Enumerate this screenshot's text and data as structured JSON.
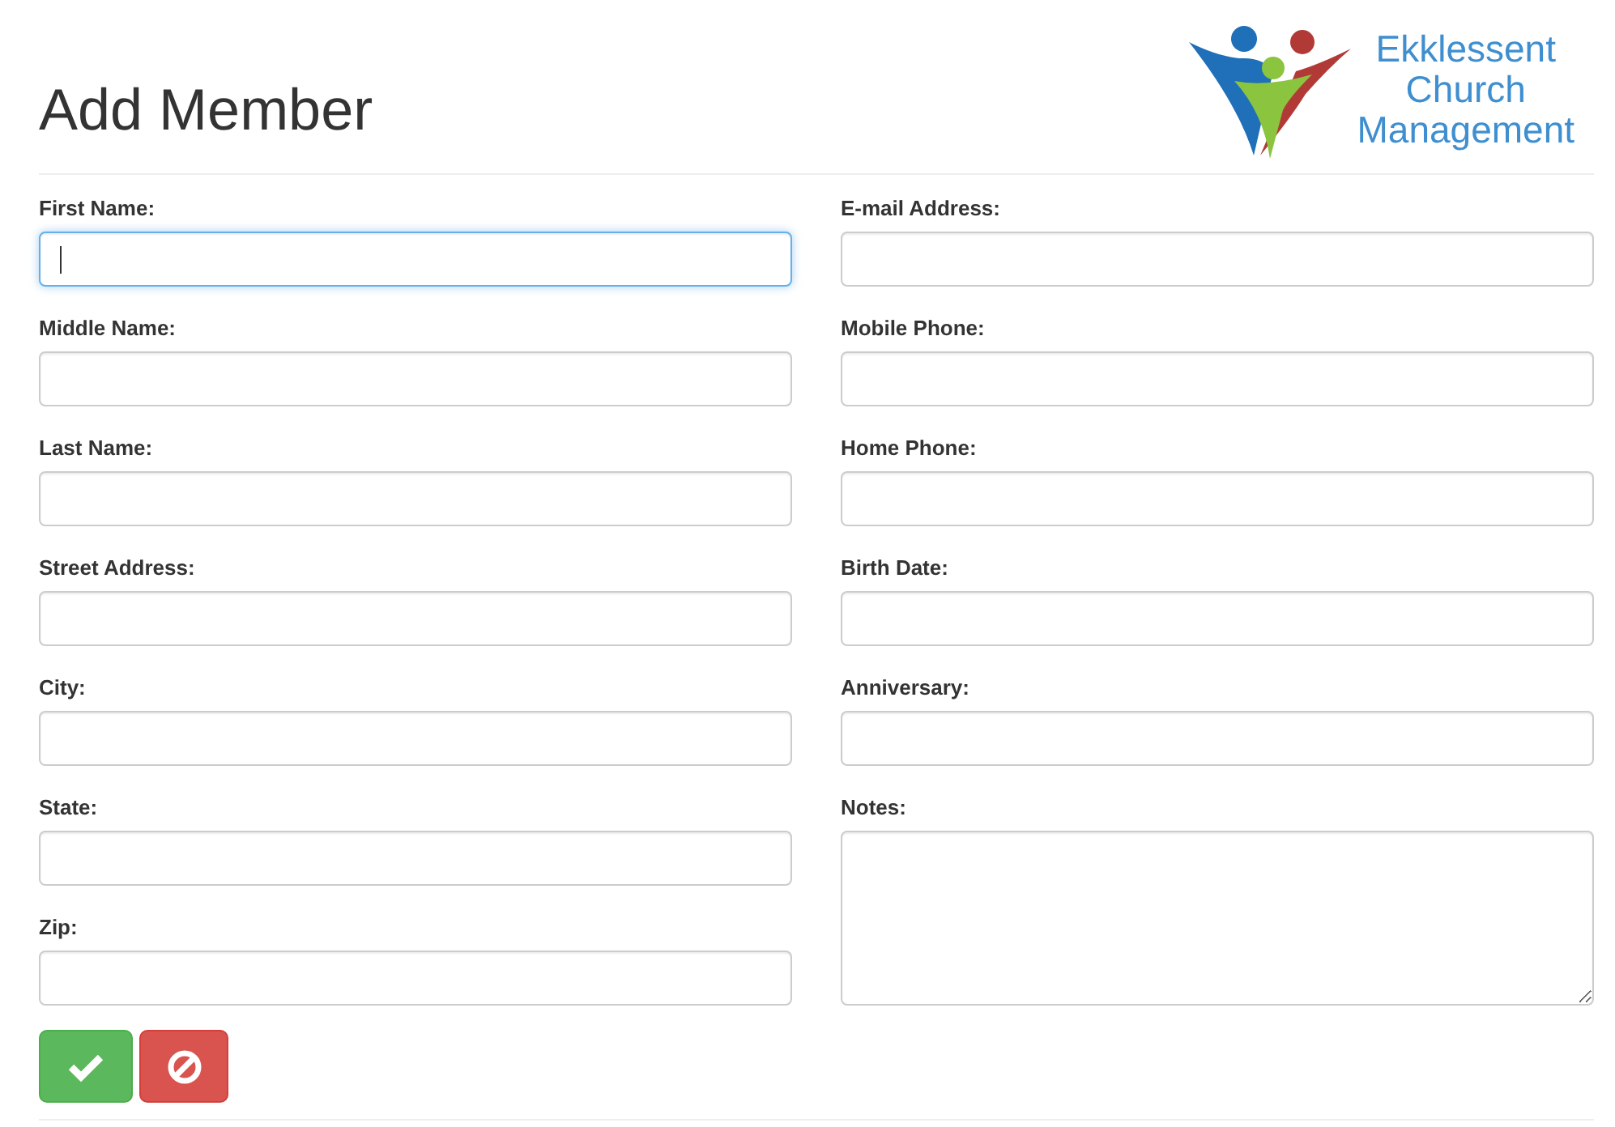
{
  "page": {
    "title": "Add Member"
  },
  "logo": {
    "lines": [
      "Ekklessent",
      "Church",
      "Management"
    ]
  },
  "form": {
    "left_fields": [
      {
        "label": "First Name:",
        "kind": "input",
        "focused": true
      },
      {
        "label": "Middle Name:",
        "kind": "input",
        "focused": false
      },
      {
        "label": "Last Name:",
        "kind": "input",
        "focused": false
      },
      {
        "label": "Street Address:",
        "kind": "input",
        "focused": false
      },
      {
        "label": "City:",
        "kind": "input",
        "focused": false
      },
      {
        "label": "State:",
        "kind": "input",
        "focused": false
      },
      {
        "label": "Zip:",
        "kind": "input",
        "focused": false
      }
    ],
    "right_fields": [
      {
        "label": "E-mail Address:",
        "kind": "input",
        "focused": false
      },
      {
        "label": "Mobile Phone:",
        "kind": "input",
        "focused": false
      },
      {
        "label": "Home Phone:",
        "kind": "input",
        "focused": false
      },
      {
        "label": "Birth Date:",
        "kind": "input",
        "focused": false
      },
      {
        "label": "Anniversary:",
        "kind": "input",
        "focused": false
      },
      {
        "label": "Notes:",
        "kind": "textarea",
        "focused": false
      }
    ],
    "buttons": [
      {
        "kind": "save"
      },
      {
        "kind": "cancel"
      }
    ]
  }
}
